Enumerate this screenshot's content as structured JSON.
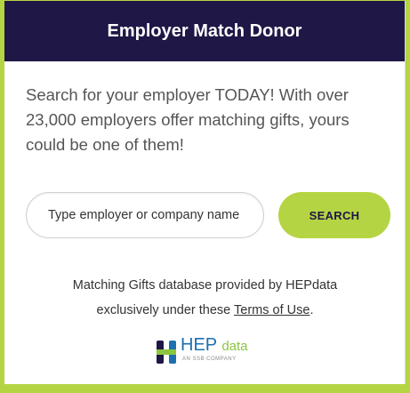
{
  "header": {
    "title": "Employer Match Donor"
  },
  "intro": {
    "text": "Search for your employer TODAY! With over 23,000 employers offer matching gifts, yours could be one of them!"
  },
  "search": {
    "placeholder": "Type employer or company name",
    "button_label": "SEARCH"
  },
  "credit": {
    "line1": "Matching Gifts database provided by HEPdata",
    "line2_prefix": "exclusively under these ",
    "terms_link": "Terms of Use",
    "line2_suffix": "."
  },
  "logo": {
    "brand": "HEP",
    "brand_suffix": "data",
    "tagline": "AN SSB COMPANY"
  },
  "colors": {
    "header_bg": "#1f1746",
    "accent": "#b5d443",
    "logo_blue": "#1d6fb0",
    "logo_green": "#8cc63f"
  }
}
